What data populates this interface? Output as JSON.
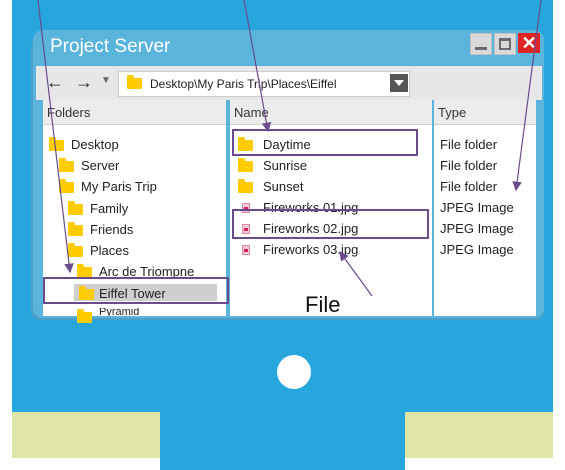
{
  "window": {
    "title": "Project Server"
  },
  "address": {
    "path": "Desktop\\My Paris Trip\\Places\\Eiffel"
  },
  "columns": {
    "folders": "Folders",
    "name": "Name",
    "type": "Type"
  },
  "folder_tree": [
    {
      "label": "Desktop"
    },
    {
      "label": "Server"
    },
    {
      "label": "My Paris Trip"
    },
    {
      "label": "Family"
    },
    {
      "label": "Friends"
    },
    {
      "label": "Places"
    },
    {
      "label": "Arc de Triompne"
    },
    {
      "label": "Eiffel Tower",
      "selected": true
    },
    {
      "label": "Pyramid"
    }
  ],
  "files": [
    {
      "name": "Daytime",
      "type": "File folder",
      "icon": "folder-icon"
    },
    {
      "name": "Sunrise",
      "type": "File folder",
      "icon": "folder-icon"
    },
    {
      "name": "Sunset",
      "type": "File folder",
      "icon": "folder-icon"
    },
    {
      "name": "Fireworks 01.jpg",
      "type": "JPEG Image",
      "icon": "jpeg-file-icon"
    },
    {
      "name": "Fireworks 02.jpg",
      "type": "JPEG Image",
      "icon": "jpeg-file-icon"
    },
    {
      "name": "Fireworks 03.jpg",
      "type": "JPEG Image",
      "icon": "jpeg-file-icon"
    }
  ],
  "callouts": {
    "file_label": "File"
  },
  "colors": {
    "monitor": "#27a6de",
    "stand_base": "#dfe6a5",
    "window_frame": "#5bb4dc",
    "highlight_box": "#6a4c8c",
    "folder": "#ffcc00",
    "close_button": "#e02323"
  }
}
